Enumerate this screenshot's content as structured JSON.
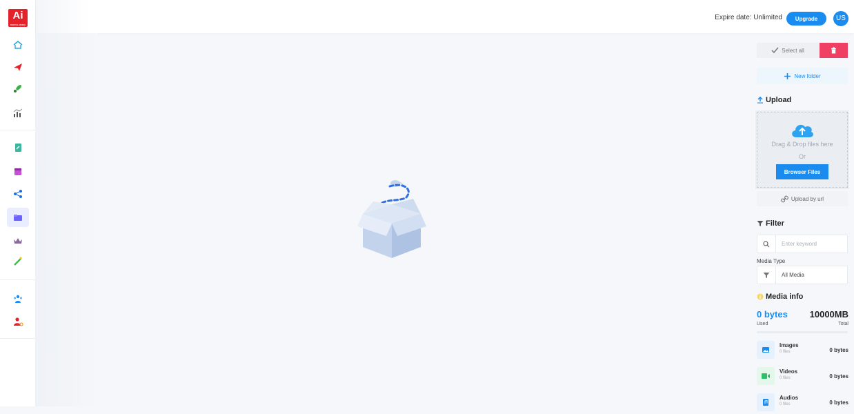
{
  "app": {
    "logo_text": "Ai",
    "logo_subtext": "DIGITAL MEDIA"
  },
  "header": {
    "expire_label": "Expire date: Unlimited",
    "upgrade_label": "Upgrade",
    "user_initials": "US"
  },
  "sidebar": {
    "icons": [
      "home-icon",
      "send-icon",
      "rocket-icon",
      "analytics-icon",
      "edit-document-icon",
      "calendar-icon",
      "share-nodes-icon",
      "folder-icon",
      "crown-icon",
      "magic-wand-icon",
      "team-icon",
      "user-shield-icon"
    ],
    "active": "folder-icon"
  },
  "toolbar": {
    "select_all_label": "Select all",
    "new_folder_label": "New folder"
  },
  "upload": {
    "title": "Upload",
    "drag_text": "Drag & Drop files here",
    "or_text": "Or",
    "browse_label": "Browser Files",
    "upload_url_label": "Upload by url"
  },
  "filter": {
    "title": "Filter",
    "keyword_placeholder": "Enter keyword",
    "media_type_label": "Media Type",
    "media_type_value": "All Media"
  },
  "media_info": {
    "title": "Media info",
    "used_value": "0 bytes",
    "total_value": "10000MB",
    "used_label": "Used",
    "total_label": "Total",
    "used_fraction": 0,
    "items": [
      {
        "name": "Images",
        "count": "0 files",
        "size": "0 bytes",
        "icon": "image-icon"
      },
      {
        "name": "Videos",
        "count": "0 files",
        "size": "0 bytes",
        "icon": "video-icon"
      },
      {
        "name": "Audios",
        "count": "0 files",
        "size": "0 bytes",
        "icon": "audio-icon"
      }
    ]
  },
  "colors": {
    "primary": "#1a8cf0",
    "danger": "#ef3f63",
    "brand_red": "#e5212a"
  }
}
